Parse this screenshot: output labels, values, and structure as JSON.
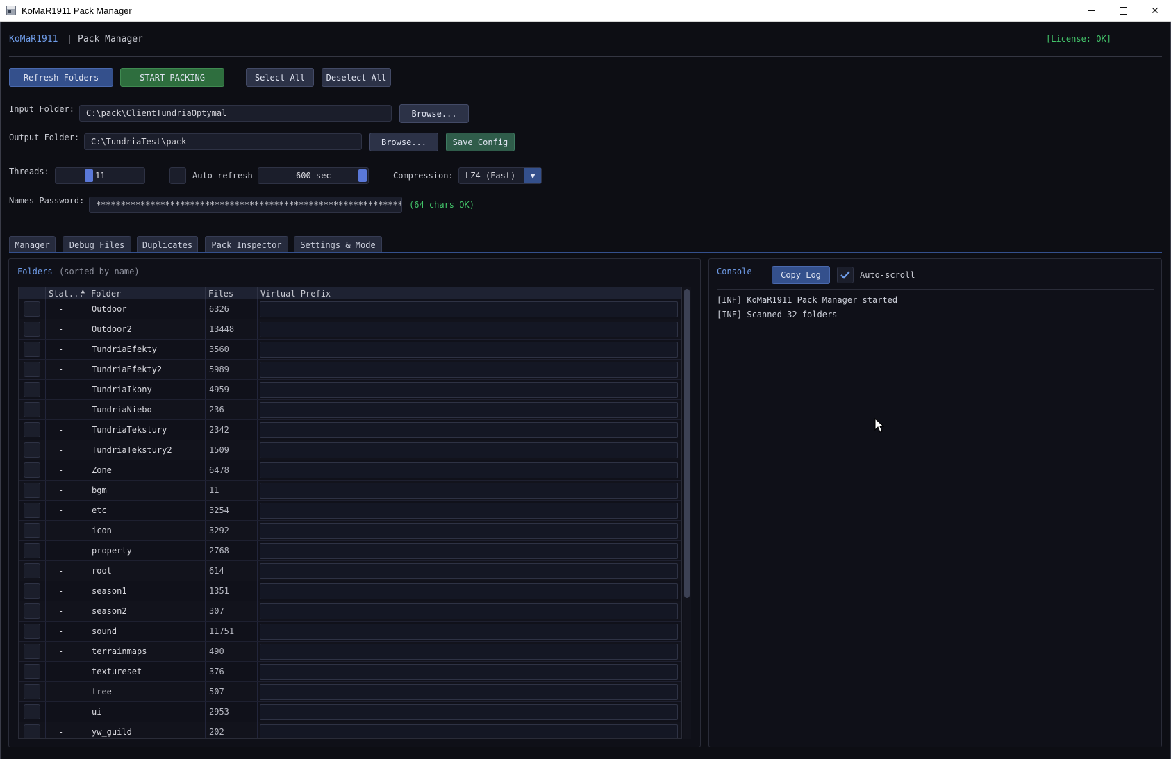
{
  "window": {
    "title": "KoMaR1911 Pack Manager"
  },
  "header": {
    "brand": "KoMaR1911",
    "separator": "|",
    "subtitle": "Pack Manager",
    "license": "[License: OK]"
  },
  "toolbar": {
    "refresh": "Refresh Folders",
    "start": "START PACKING",
    "select_all": "Select All",
    "deselect_all": "Deselect All"
  },
  "input_folder": {
    "label": "Input Folder:",
    "value": "C:\\pack\\ClientTundriaOptymal",
    "browse": "Browse..."
  },
  "output_folder": {
    "label": "Output Folder:",
    "value": "C:\\TundriaTest\\pack",
    "browse": "Browse...",
    "save": "Save Config"
  },
  "threads": {
    "label": "Threads:",
    "value": "11",
    "level": 0.36
  },
  "auto_refresh": {
    "label": "Auto-refresh",
    "checked": false,
    "interval": "600 sec",
    "level": 1.0
  },
  "compression": {
    "label": "Compression:",
    "value": "LZ4 (Fast)"
  },
  "password": {
    "label": "Names Password:",
    "value": "****************************************************************",
    "status": "(64 chars OK)"
  },
  "tabs": [
    {
      "label": "Manager",
      "active": true
    },
    {
      "label": "Debug Files",
      "active": false
    },
    {
      "label": "Duplicates",
      "active": false
    },
    {
      "label": "Pack Inspector",
      "active": false
    },
    {
      "label": "Settings & Mode",
      "active": false
    }
  ],
  "folders": {
    "title": "Folders",
    "subtitle": "(sorted by name)",
    "columns": {
      "status": "Stat...",
      "folder": "Folder",
      "files": "Files",
      "prefix": "Virtual Prefix"
    },
    "rows": [
      {
        "status": "-",
        "folder": "Outdoor",
        "files": "6326"
      },
      {
        "status": "-",
        "folder": "Outdoor2",
        "files": "13448"
      },
      {
        "status": "-",
        "folder": "TundriaEfekty",
        "files": "3560"
      },
      {
        "status": "-",
        "folder": "TundriaEfekty2",
        "files": "5989"
      },
      {
        "status": "-",
        "folder": "TundriaIkony",
        "files": "4959"
      },
      {
        "status": "-",
        "folder": "TundriaNiebo",
        "files": "236"
      },
      {
        "status": "-",
        "folder": "TundriaTekstury",
        "files": "2342"
      },
      {
        "status": "-",
        "folder": "TundriaTekstury2",
        "files": "1509"
      },
      {
        "status": "-",
        "folder": "Zone",
        "files": "6478"
      },
      {
        "status": "-",
        "folder": "bgm",
        "files": "11"
      },
      {
        "status": "-",
        "folder": "etc",
        "files": "3254"
      },
      {
        "status": "-",
        "folder": "icon",
        "files": "3292"
      },
      {
        "status": "-",
        "folder": "property",
        "files": "2768"
      },
      {
        "status": "-",
        "folder": "root",
        "files": "614"
      },
      {
        "status": "-",
        "folder": "season1",
        "files": "1351"
      },
      {
        "status": "-",
        "folder": "season2",
        "files": "307"
      },
      {
        "status": "-",
        "folder": "sound",
        "files": "11751"
      },
      {
        "status": "-",
        "folder": "terrainmaps",
        "files": "490"
      },
      {
        "status": "-",
        "folder": "textureset",
        "files": "376"
      },
      {
        "status": "-",
        "folder": "tree",
        "files": "507"
      },
      {
        "status": "-",
        "folder": "ui",
        "files": "2953"
      },
      {
        "status": "-",
        "folder": "yw_guild",
        "files": "202"
      }
    ]
  },
  "console": {
    "title": "Console",
    "copy": "Copy Log",
    "autoscroll": "Auto-scroll",
    "autoscroll_checked": true,
    "lines": [
      "[INF] KoMaR1911 Pack Manager started",
      "[INF] Scanned 32 folders"
    ]
  },
  "colors": {
    "accent": "#34508c",
    "brand": "#6f9ce8",
    "ok": "#43c46a",
    "start": "#2e6e3e"
  }
}
